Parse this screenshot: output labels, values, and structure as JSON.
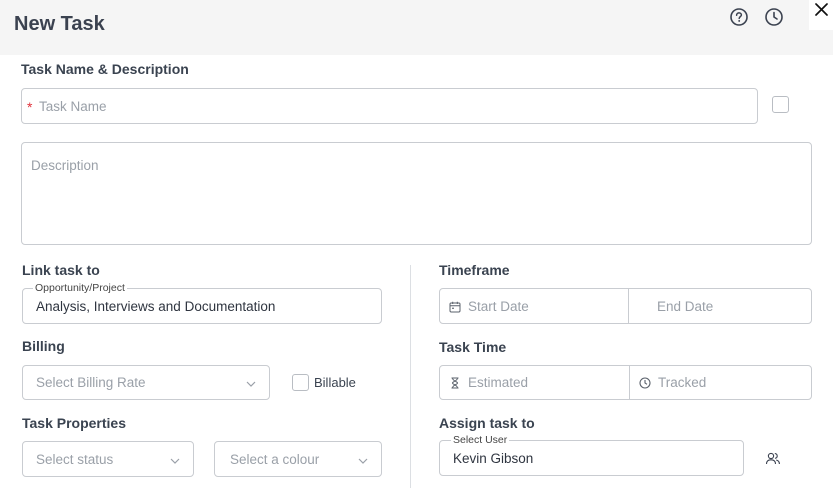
{
  "header": {
    "title": "New Task",
    "help_icon": "help-circle-icon",
    "history_icon": "clock-icon",
    "close_icon": "close-icon"
  },
  "task_name_description": {
    "section_label": "Task Name & Description",
    "required_mark": "*",
    "task_name_placeholder": "Task Name",
    "description_placeholder": "Description"
  },
  "link_task": {
    "section_label": "Link task to",
    "field_legend": "Opportunity/Project",
    "field_value": "Analysis, Interviews and Documentation"
  },
  "billing": {
    "section_label": "Billing",
    "rate_placeholder": "Select Billing Rate",
    "billable_label": "Billable"
  },
  "task_properties": {
    "section_label": "Task Properties",
    "status_placeholder": "Select status",
    "colour_placeholder": "Select a colour"
  },
  "timeframe": {
    "section_label": "Timeframe",
    "start_placeholder": "Start Date",
    "end_placeholder": "End Date"
  },
  "task_time": {
    "section_label": "Task Time",
    "estimated_placeholder": "Estimated",
    "tracked_placeholder": "Tracked"
  },
  "assign": {
    "section_label": "Assign task to",
    "field_legend": "Select User",
    "field_value": "Kevin Gibson",
    "users_icon": "users-icon"
  },
  "colors": {
    "required": "#e0303a",
    "header_bg": "#f5f5f5",
    "border": "#c9ccd1"
  }
}
